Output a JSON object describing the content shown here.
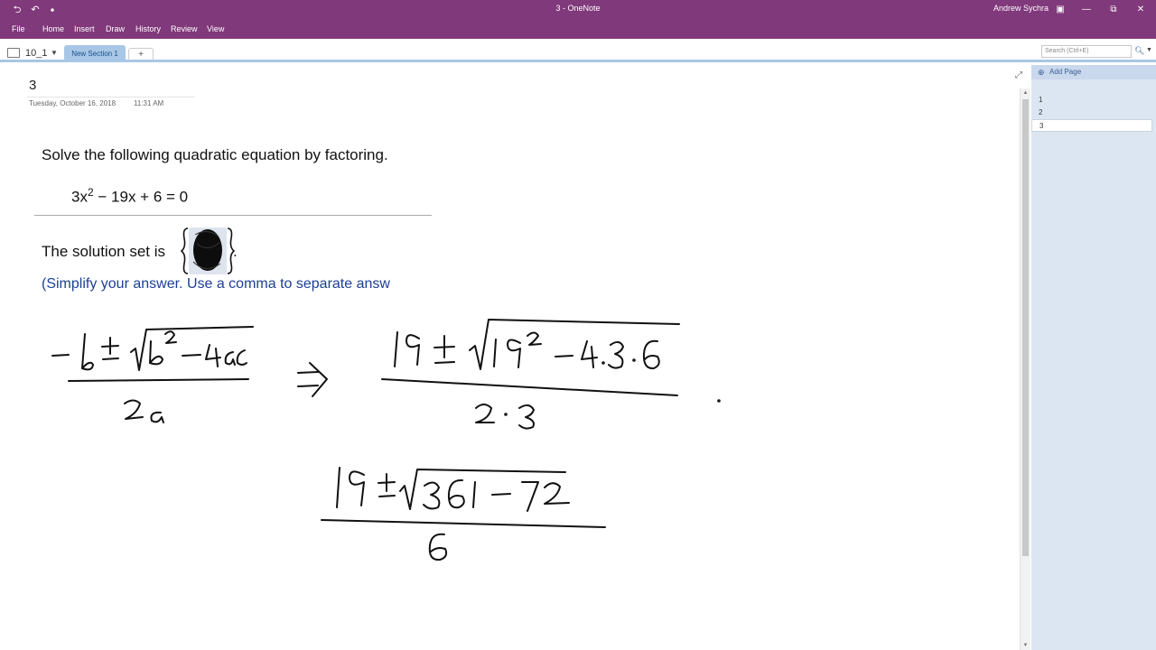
{
  "window": {
    "title": "3  -  OneNote",
    "user": "Andrew Sychra"
  },
  "menu": {
    "items": [
      "File",
      "Home",
      "Insert",
      "Draw",
      "History",
      "Review",
      "View"
    ]
  },
  "notebook": {
    "name": "10_1",
    "section_tab": "New Section 1",
    "add_section": "+"
  },
  "search": {
    "placeholder": "Search (Ctrl+E)"
  },
  "page": {
    "title": "3",
    "date": "Tuesday, October 16, 2018",
    "time": "11:31 AM"
  },
  "question": {
    "instruction": "Solve the following quadratic equation by factoring.",
    "equation_lhs": "3x",
    "equation_exp": "2",
    "equation_rest": " − 19x + 6 = 0",
    "solution_prefix": "The solution set is",
    "solution_suffix": ".",
    "hint": "(Simplify your answer. Use a comma to separate answ"
  },
  "pane": {
    "add_page": "Add Page",
    "pages": [
      "1",
      "2",
      "3"
    ],
    "active_page": "3"
  },
  "colors": {
    "titlebar": "#80397b",
    "section_tab": "#a8c7e6",
    "page_pane": "#dce6f3",
    "hint_text": "#1d3f96"
  },
  "icons": {
    "back": "back-arrow-icon",
    "undo": "undo-icon",
    "expand": "expand-icon",
    "search": "search-icon",
    "add_page": "add-page-plus-icon"
  }
}
